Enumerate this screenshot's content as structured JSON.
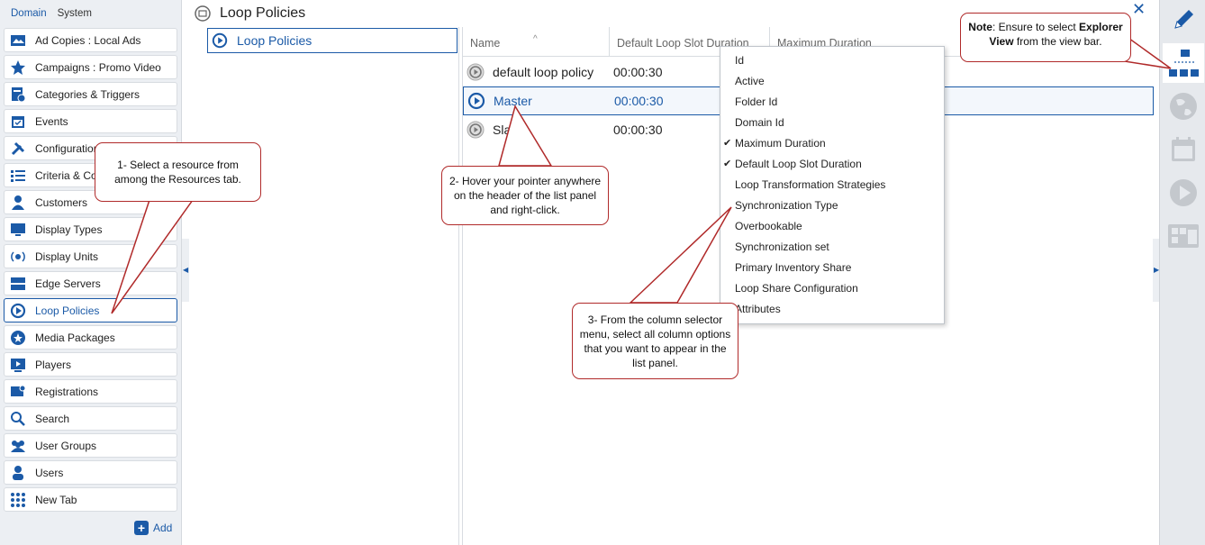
{
  "left_panel": {
    "tabs": [
      "Domain",
      "System"
    ],
    "items": [
      {
        "label": "Ad Copies : Local Ads",
        "icon": "ad-copies-icon"
      },
      {
        "label": "Campaigns : Promo Video",
        "icon": "star-icon"
      },
      {
        "label": "Categories & Triggers",
        "icon": "categories-icon"
      },
      {
        "label": "Events",
        "icon": "calendar-icon"
      },
      {
        "label": "Configuration",
        "icon": "tools-icon"
      },
      {
        "label": "Criteria & Co",
        "icon": "criteria-icon"
      },
      {
        "label": "Customers",
        "icon": "customer-icon"
      },
      {
        "label": "Display Types",
        "icon": "display-types-icon"
      },
      {
        "label": "Display Units",
        "icon": "display-units-icon"
      },
      {
        "label": "Edge Servers",
        "icon": "server-icon"
      },
      {
        "label": "Loop Policies",
        "icon": "loop-icon",
        "selected": true
      },
      {
        "label": "Media Packages",
        "icon": "media-packages-icon"
      },
      {
        "label": "Players",
        "icon": "player-icon"
      },
      {
        "label": "Registrations",
        "icon": "registration-icon"
      },
      {
        "label": "Search",
        "icon": "search-icon"
      },
      {
        "label": "User Groups",
        "icon": "user-groups-icon"
      },
      {
        "label": "Users",
        "icon": "user-icon"
      },
      {
        "label": "New Tab",
        "icon": "grid-icon"
      }
    ],
    "add_label": "Add"
  },
  "main": {
    "title": "Loop Policies",
    "tree_item": "Loop Policies",
    "columns": [
      "Name",
      "Default Loop Slot Duration",
      "Maximum Duration"
    ],
    "rows": [
      {
        "name": "default loop policy",
        "duration": "00:00:30"
      },
      {
        "name": "Master",
        "duration": "00:00:30",
        "selected": true
      },
      {
        "name": "Slave",
        "duration": "00:00:30"
      }
    ]
  },
  "column_menu": {
    "items": [
      {
        "label": "Id",
        "checked": false
      },
      {
        "label": "Active",
        "checked": false
      },
      {
        "label": "Folder Id",
        "checked": false
      },
      {
        "label": "Domain Id",
        "checked": false
      },
      {
        "label": "Maximum Duration",
        "checked": true
      },
      {
        "label": "Default Loop Slot Duration",
        "checked": true
      },
      {
        "label": "Loop Transformation Strategies",
        "checked": false
      },
      {
        "label": "Synchronization Type",
        "checked": false
      },
      {
        "label": "Overbookable",
        "checked": false
      },
      {
        "label": "Synchronization set",
        "checked": false
      },
      {
        "label": "Primary Inventory Share",
        "checked": false
      },
      {
        "label": "Loop Share Configuration",
        "checked": false
      },
      {
        "label": "Attributes",
        "checked": false
      }
    ]
  },
  "callouts": {
    "step1": "1- Select a resource from among the Resources tab.",
    "step2": "2- Hover your pointer anywhere on the header of the list panel and right-click.",
    "step3": "3- From the column selector menu, select all column options that you want to appear in the list panel.",
    "note_bold": "Note",
    "note_text1": ": Ensure to select ",
    "note_bold2": "Explorer View",
    "note_text2": " from the view bar."
  },
  "view_bar": [
    "edit-icon",
    "explorer-view-icon",
    "globe-icon",
    "calendar-view-icon",
    "play-icon",
    "gallery-icon"
  ],
  "colors": {
    "accent": "#1b5aa7",
    "callout_border": "#b02a2a"
  }
}
